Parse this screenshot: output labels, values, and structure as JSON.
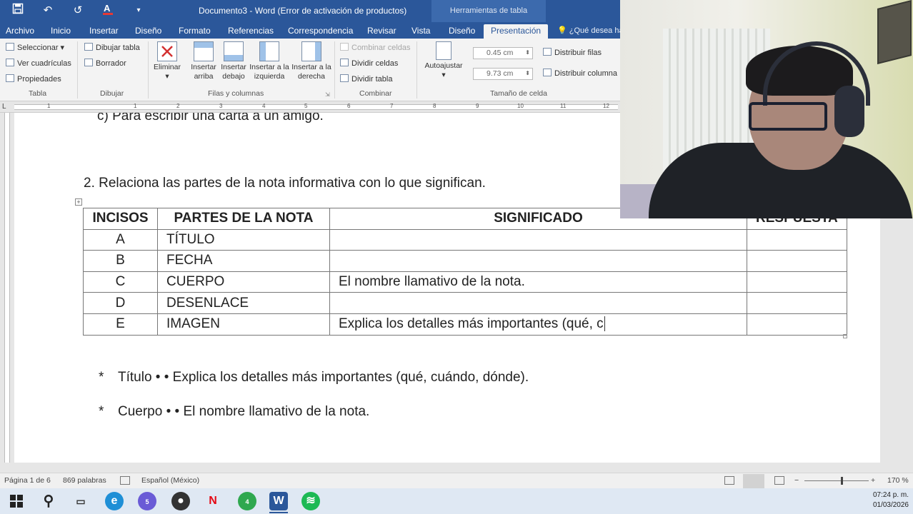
{
  "window": {
    "title": "Documento3 - Word (Error de activación de productos)",
    "context_title": "Herramientas de tabla"
  },
  "qat": {
    "save_icon": "save-icon",
    "undo_icon": "undo-icon",
    "redo_icon": "redo-icon",
    "font_color_icon": "font-color-icon",
    "customize_icon": "chevron-down-icon"
  },
  "tabs": [
    {
      "label": "Archivo"
    },
    {
      "label": "Inicio"
    },
    {
      "label": "Insertar"
    },
    {
      "label": "Diseño"
    },
    {
      "label": "Formato"
    },
    {
      "label": "Referencias"
    },
    {
      "label": "Correspondencia"
    },
    {
      "label": "Revisar"
    },
    {
      "label": "Vista"
    },
    {
      "label": "Diseño"
    },
    {
      "label": "Presentación"
    }
  ],
  "tell_me": "¿Qué desea ha",
  "ribbon": {
    "tabla": {
      "label": "Tabla",
      "seleccionar": "Seleccionar",
      "ver_cuadriculas": "Ver cuadrículas",
      "propiedades": "Propiedades"
    },
    "dibujar": {
      "label": "Dibujar",
      "dibujar_tabla": "Dibujar tabla",
      "borrador": "Borrador"
    },
    "filas_columnas": {
      "label": "Filas y columnas",
      "eliminar": "Eliminar",
      "insertar_arriba": "Insertar arriba",
      "insertar_debajo": "Insertar debajo",
      "insertar_izquierda": "Insertar a la izquierda",
      "insertar_derecha": "Insertar a la derecha"
    },
    "combinar": {
      "label": "Combinar",
      "combinar_celdas": "Combinar celdas",
      "dividir_celdas": "Dividir celdas",
      "dividir_tabla": "Dividir tabla"
    },
    "tamano": {
      "label": "Tamaño de celda",
      "autoajustar": "Autoajustar",
      "alto": "0.45 cm",
      "ancho": "9.73 cm",
      "distribuir_filas": "Distribuir filas",
      "distribuir_columnas": "Distribuir columna"
    }
  },
  "ruler": {
    "numbers": [
      "1",
      "1",
      "2",
      "3",
      "4",
      "5",
      "6",
      "7",
      "8",
      "9",
      "10",
      "11",
      "12"
    ]
  },
  "document": {
    "previous_line": "c) Para escribir una carta a un amigo.",
    "question": "2.  Relaciona las partes de la nota informativa con lo que significan.",
    "table": {
      "headers": [
        "INCISOS",
        "PARTES DE LA NOTA",
        "SIGNIFICADO",
        "RESPUESTA"
      ],
      "rows": [
        [
          "A",
          "TÍTULO",
          "",
          ""
        ],
        [
          "B",
          "FECHA",
          "",
          ""
        ],
        [
          "C",
          "CUERPO",
          "El nombre llamativo de la nota.",
          ""
        ],
        [
          "D",
          "DESENLACE",
          "",
          ""
        ],
        [
          "E",
          "IMAGEN",
          "Explica los detalles más importantes (qué, c",
          ""
        ]
      ]
    },
    "bullets": [
      {
        "star": "*",
        "text": "Título • • Explica los detalles más importantes (qué, cuándo, dónde)."
      },
      {
        "star": "*",
        "text": "Cuerpo • • El nombre llamativo de la nota."
      }
    ]
  },
  "statusbar": {
    "page": "Página 1 de 6",
    "words": "869 palabras",
    "language": "Español (México)",
    "zoom_minus": "−",
    "zoom_plus": "+",
    "zoom": "170 %"
  },
  "taskbar": {
    "notifications_edge": "5",
    "notifications_whatsapp": "4",
    "netflix": "N",
    "word": "W",
    "time": "07:24 p. m.",
    "date": "01/03/2026"
  }
}
